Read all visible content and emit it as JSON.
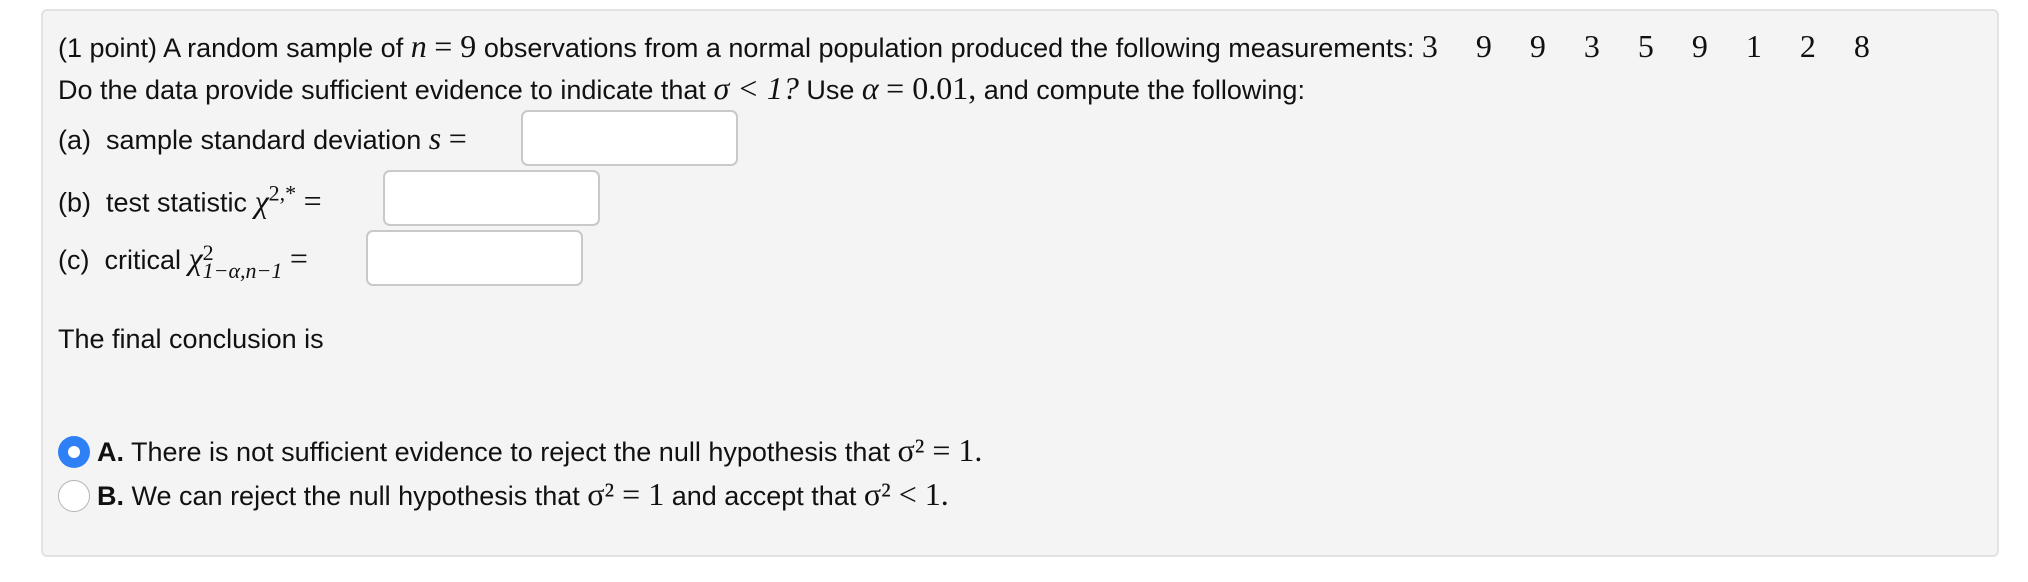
{
  "problem": {
    "points_label": "(1 point)",
    "intro": "A random sample of",
    "n_var": "n",
    "n_eq": "= 9",
    "intro2": "observations from a normal population produced the following measurements:",
    "measurements": [
      "3",
      "9",
      "9",
      "3",
      "5",
      "9",
      "1",
      "2",
      "8"
    ],
    "question_pre": "Do the data provide sufficient evidence to indicate that",
    "sigma_cond": "σ < 1?",
    "use_alpha": "Use",
    "alpha": "α",
    "alpha_eq": "= 0.01,",
    "question_post": "and compute the following:"
  },
  "parts": [
    {
      "label": "(a)",
      "text": "sample standard deviation",
      "symbol": "s",
      "eq": "=",
      "value": ""
    },
    {
      "label": "(b)",
      "text": "test statistic",
      "symbol": "χ",
      "sup": "2,*",
      "eq": "=",
      "value": ""
    },
    {
      "label": "(c)",
      "text": "critical",
      "symbol": "χ",
      "sup": "2",
      "sub": "1−α,n−1",
      "eq": "=",
      "value": ""
    }
  ],
  "conclusion_label": "The final conclusion is",
  "options": [
    {
      "letter": "A.",
      "text": "There is not sufficient evidence to reject the null hypothesis that",
      "math": "σ² = 1.",
      "selected": true
    },
    {
      "letter": "B.",
      "text": "We can reject the null hypothesis that",
      "math": "σ² = 1",
      "text2": "and accept that",
      "math2": "σ² < 1.",
      "selected": false
    }
  ],
  "colors": {
    "radio_selected": "#2f80f5",
    "panel_bg": "#f4f4f4"
  }
}
